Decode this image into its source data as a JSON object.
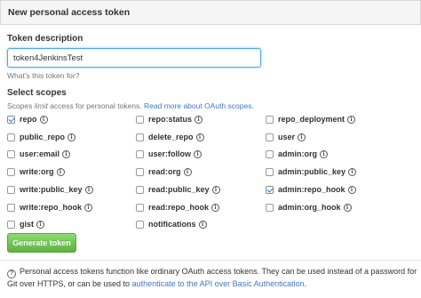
{
  "header": {
    "title": "New personal access token"
  },
  "description": {
    "label": "Token description",
    "value": "token4JenkinsTest",
    "note": "What's this token for?"
  },
  "scopes": {
    "label": "Select scopes",
    "help_prefix": "Scopes ",
    "help_em": "limit",
    "help_middle": " access for personal tokens. ",
    "help_link": "Read more about OAuth scopes.",
    "items": [
      {
        "label": "repo",
        "checked": true
      },
      {
        "label": "repo:status",
        "checked": false
      },
      {
        "label": "repo_deployment",
        "checked": false
      },
      {
        "label": "public_repo",
        "checked": false
      },
      {
        "label": "delete_repo",
        "checked": false
      },
      {
        "label": "user",
        "checked": false
      },
      {
        "label": "user:email",
        "checked": false
      },
      {
        "label": "user:follow",
        "checked": false
      },
      {
        "label": "admin:org",
        "checked": false
      },
      {
        "label": "write:org",
        "checked": false
      },
      {
        "label": "read:org",
        "checked": false
      },
      {
        "label": "admin:public_key",
        "checked": false
      },
      {
        "label": "write:public_key",
        "checked": false
      },
      {
        "label": "read:public_key",
        "checked": false
      },
      {
        "label": "admin:repo_hook",
        "checked": true
      },
      {
        "label": "write:repo_hook",
        "checked": false
      },
      {
        "label": "read:repo_hook",
        "checked": false
      },
      {
        "label": "admin:org_hook",
        "checked": false
      },
      {
        "label": "gist",
        "checked": false
      },
      {
        "label": "notifications",
        "checked": false
      }
    ]
  },
  "actions": {
    "generate_label": "Generate token"
  },
  "footer": {
    "text_before": "Personal access tokens function like ordinary OAuth access tokens. They can be used instead of a password for Git over HTTPS, or can be used to ",
    "link": "authenticate to the API over Basic Authentication",
    "text_after": "."
  },
  "colors": {
    "accent_link": "#4078c0",
    "button_green": "#60b044",
    "checkbox_check": "#1e6fd9"
  }
}
